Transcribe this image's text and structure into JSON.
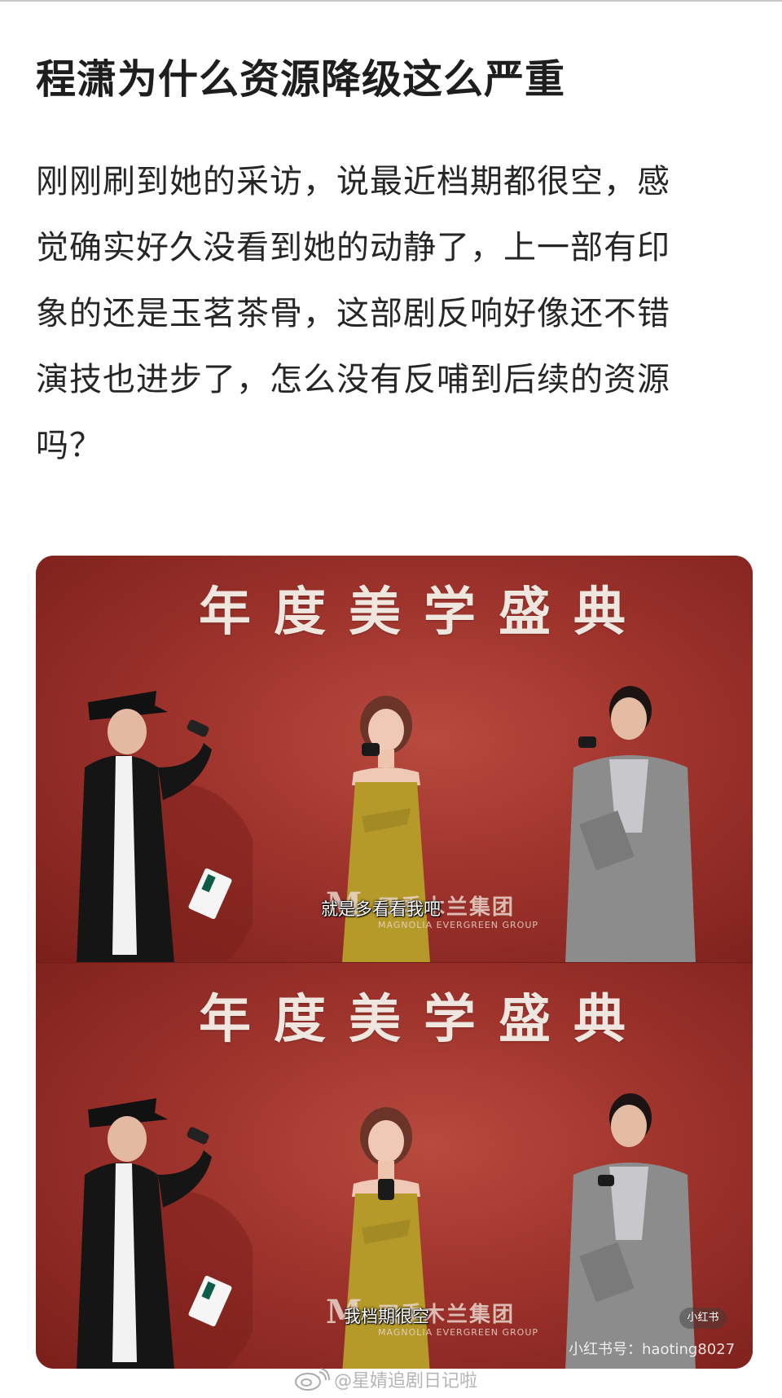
{
  "post": {
    "title": "程潇为什么资源降级这么严重",
    "body_lines": [
      "刚刚刷到她的采访，说最近档期都很空，感",
      "觉确实好久没看到她的动静了，上一部有印",
      "象的还是玉茗茶骨，这部剧反响好像还不错",
      "演技也进步了，怎么没有反哺到后续的资源",
      "吗？"
    ]
  },
  "media": {
    "panels": [
      {
        "stage_title": "年度美学盛典",
        "sponsor_mark": "M",
        "sponsor_cn": "四季木兰集团",
        "sponsor_en": "MAGNOLIA EVERGREEN GROUP",
        "subtitle": "就是多看看我吧"
      },
      {
        "stage_title": "年度美学盛典",
        "sponsor_mark": "M",
        "sponsor_cn": "四季木兰集团",
        "sponsor_en": "MAGNOLIA EVERGREEN GROUP",
        "subtitle": "我档期很空",
        "badge": "小红书",
        "account": "小红书号：haoting8027"
      }
    ]
  },
  "weibo_watermark": {
    "icon": "weibo-logo-icon",
    "text": "@星婧追剧日记啦"
  },
  "colors": {
    "backdrop": "#9e332c",
    "title_text": "#1e1e1e",
    "dress": "#b59a2a",
    "suit_gray": "#8c8c8c"
  }
}
